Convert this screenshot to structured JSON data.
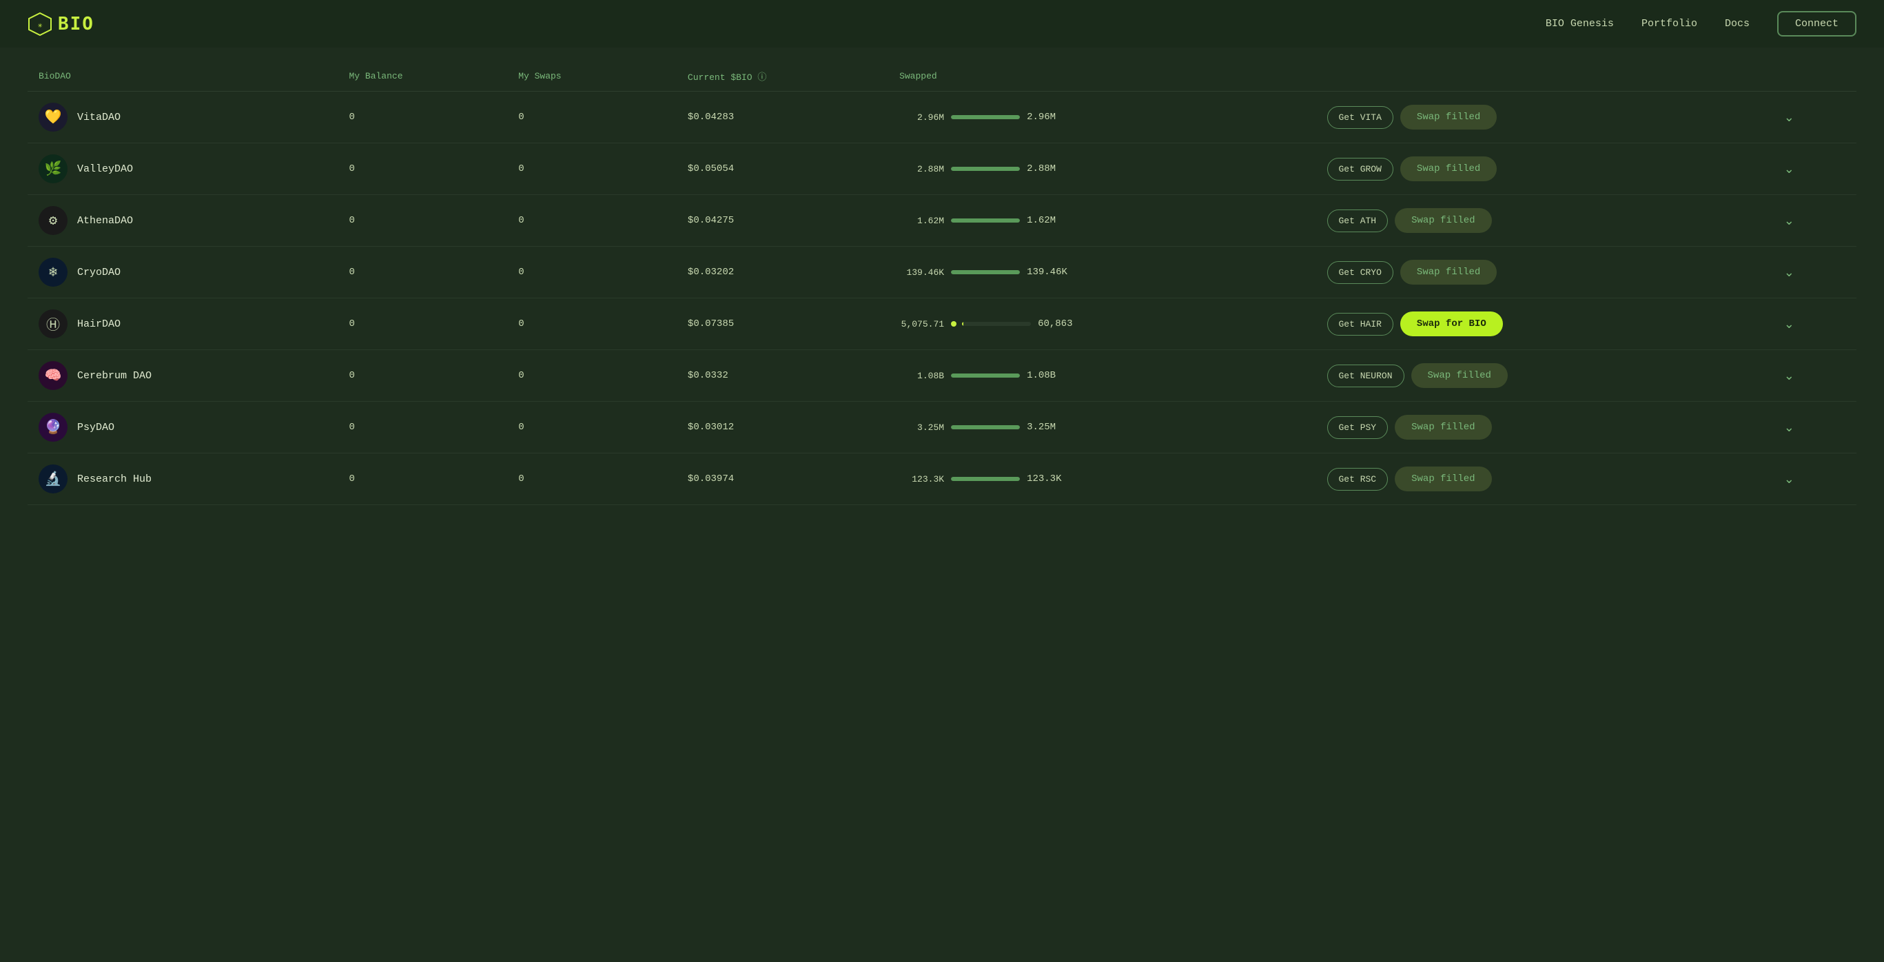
{
  "header": {
    "logo_text": "BIO",
    "logo_symbol": "✳",
    "nav": [
      {
        "label": "BIO Genesis",
        "id": "bio-genesis"
      },
      {
        "label": "Portfolio",
        "id": "portfolio"
      },
      {
        "label": "Docs",
        "id": "docs"
      }
    ],
    "connect_label": "Connect"
  },
  "table": {
    "columns": {
      "biodao": "BioDAO",
      "my_balance": "My Balance",
      "my_swaps": "My Swaps",
      "current_bio": "Current $BIO ⓘ",
      "swapped": "Swapped"
    },
    "rows": [
      {
        "id": "vitadao",
        "name": "VitaDAO",
        "avatar_color": "#1a1a2e",
        "avatar_emoji": "💛",
        "balance": "0",
        "swaps": "0",
        "price": "$0.04283",
        "amount_left": "2.96M",
        "progress_pct": 100,
        "progress_type": "full",
        "swapped_amount": "2.96M",
        "get_label": "Get VITA",
        "swap_label": "Swap filled",
        "swap_type": "filled"
      },
      {
        "id": "valleydao",
        "name": "ValleyDAO",
        "avatar_color": "#0d2a1a",
        "avatar_emoji": "🌿",
        "balance": "0",
        "swaps": "0",
        "price": "$0.05054",
        "amount_left": "2.88M",
        "progress_pct": 100,
        "progress_type": "full",
        "swapped_amount": "2.88M",
        "get_label": "Get GROW",
        "swap_label": "Swap filled",
        "swap_type": "filled"
      },
      {
        "id": "athenadao",
        "name": "AthenaDAO",
        "avatar_color": "#1a1a1a",
        "avatar_emoji": "⚙",
        "balance": "0",
        "swaps": "0",
        "price": "$0.04275",
        "amount_left": "1.62M",
        "progress_pct": 100,
        "progress_type": "full",
        "swapped_amount": "1.62M",
        "get_label": "Get ATH",
        "swap_label": "Swap filled",
        "swap_type": "filled"
      },
      {
        "id": "cryodao",
        "name": "CryoDAO",
        "avatar_color": "#0a1a2e",
        "avatar_emoji": "❄",
        "balance": "0",
        "swaps": "0",
        "price": "$0.03202",
        "amount_left": "139.46K",
        "progress_pct": 100,
        "progress_type": "full",
        "swapped_amount": "139.46K",
        "get_label": "Get CRYO",
        "swap_label": "Swap filled",
        "swap_type": "filled"
      },
      {
        "id": "hairdao",
        "name": "HairDAO",
        "avatar_color": "#1a1a1a",
        "avatar_emoji": "Ⓗ",
        "balance": "0",
        "swaps": "0",
        "price": "$0.07385",
        "amount_left": "5,075.71",
        "progress_pct": 2,
        "progress_type": "active",
        "swapped_amount": "60,863",
        "get_label": "Get HAIR",
        "swap_label": "Swap for BIO",
        "swap_type": "active"
      },
      {
        "id": "cerebrumdao",
        "name": "Cerebrum DAO",
        "avatar_color": "#2a0a2e",
        "avatar_emoji": "🧠",
        "balance": "0",
        "swaps": "0",
        "price": "$0.0332",
        "amount_left": "1.08B",
        "progress_pct": 100,
        "progress_type": "full",
        "swapped_amount": "1.08B",
        "get_label": "Get NEURON",
        "swap_label": "Swap filled",
        "swap_type": "filled"
      },
      {
        "id": "psydao",
        "name": "PsyDAO",
        "avatar_color": "#2a0a3a",
        "avatar_emoji": "🔮",
        "balance": "0",
        "swaps": "0",
        "price": "$0.03012",
        "amount_left": "3.25M",
        "progress_pct": 100,
        "progress_type": "full",
        "swapped_amount": "3.25M",
        "get_label": "Get PSY",
        "swap_label": "Swap filled",
        "swap_type": "filled"
      },
      {
        "id": "researchhub",
        "name": "Research Hub",
        "avatar_color": "#0a1a2e",
        "avatar_emoji": "🔬",
        "balance": "0",
        "swaps": "0",
        "price": "$0.03974",
        "amount_left": "123.3K",
        "progress_pct": 100,
        "progress_type": "full",
        "swapped_amount": "123.3K",
        "get_label": "Get RSC",
        "swap_label": "Swap filled",
        "swap_type": "filled"
      }
    ]
  }
}
